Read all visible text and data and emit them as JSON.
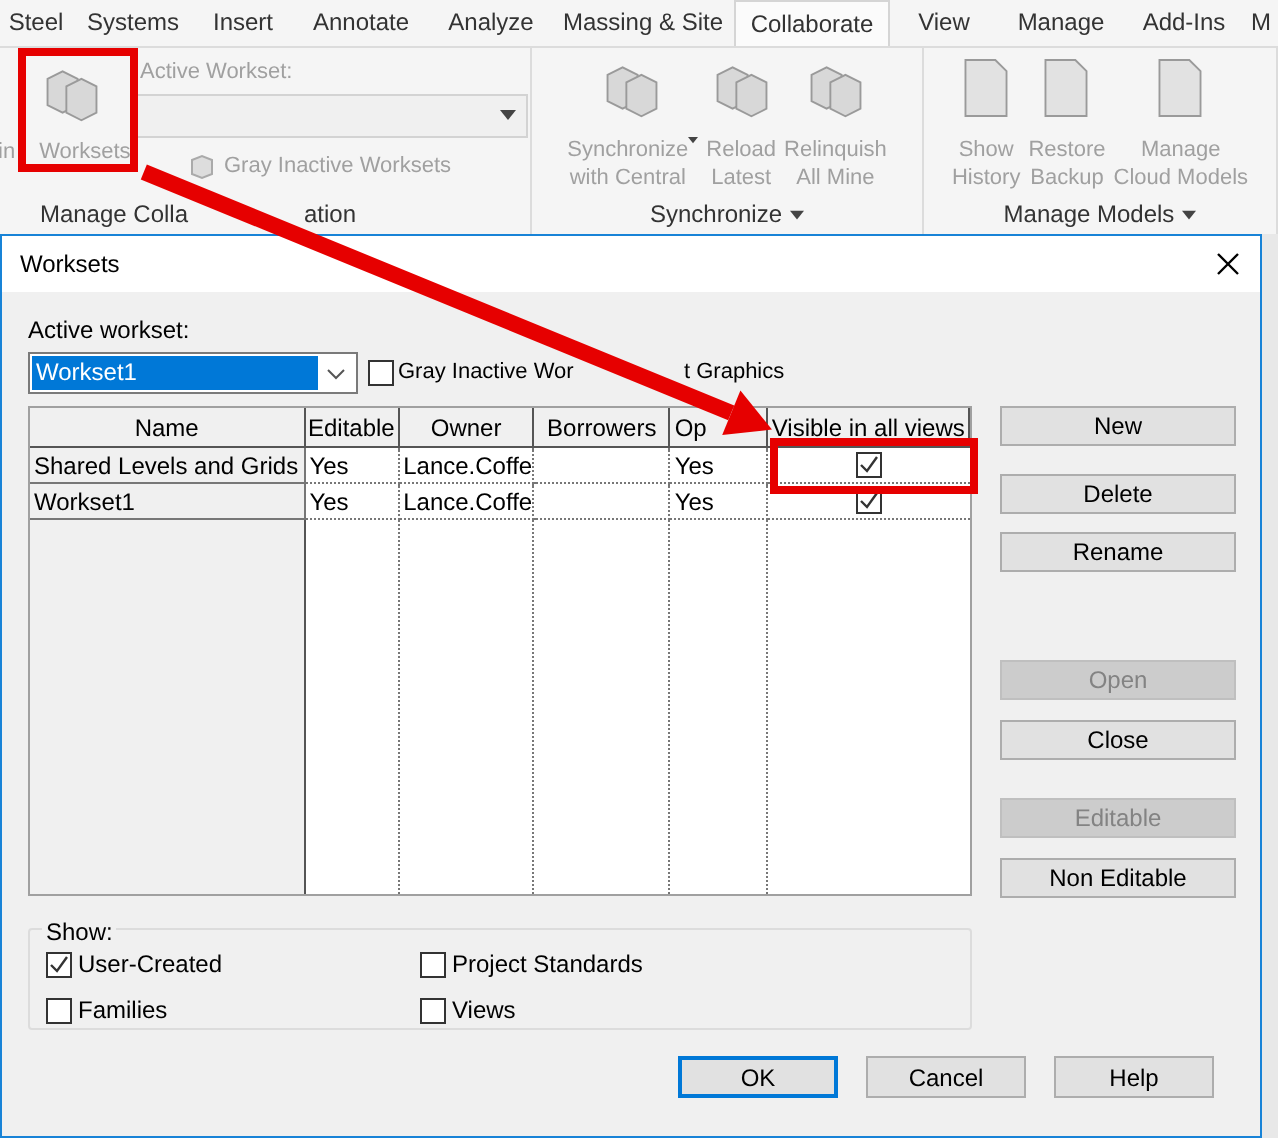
{
  "ribbon": {
    "tabs": [
      {
        "label": "Steel",
        "selected": false
      },
      {
        "label": "Systems",
        "selected": false
      },
      {
        "label": "Insert",
        "selected": false
      },
      {
        "label": "Annotate",
        "selected": false
      },
      {
        "label": "Analyze",
        "selected": false
      },
      {
        "label": "Massing & Site",
        "selected": false
      },
      {
        "label": "Collaborate",
        "selected": true
      },
      {
        "label": "View",
        "selected": false
      },
      {
        "label": "Manage",
        "selected": false
      },
      {
        "label": "Add-Ins",
        "selected": false
      },
      {
        "label": "M",
        "selected": false
      }
    ],
    "manage_collaboration": {
      "worksets_button": "in Worksets",
      "active_workset_label": "Active Workset:",
      "gray_inactive_button": "Gray Inactive Worksets",
      "label_parts": [
        "Manage Colla",
        "ation"
      ],
      "disabled": true
    },
    "synchronize": {
      "buttons": [
        {
          "label": "Synchronize\nwith Central",
          "kind": "split"
        },
        {
          "label": "Reload\nLatest",
          "kind": "plain"
        },
        {
          "label": "Relinquish\nAll Mine",
          "kind": "plain"
        }
      ],
      "label": "Synchronize",
      "disabled": true
    },
    "manage_models": {
      "buttons": [
        {
          "label": "Show\nHistory"
        },
        {
          "label": "Restore\nBackup"
        },
        {
          "label": "Manage\nCloud Models"
        }
      ],
      "label": "Manage Models",
      "disabled": true
    }
  },
  "dialog": {
    "title": "Worksets",
    "active_label": "Active workset:",
    "active_value": "Workset1",
    "gray_inactive": {
      "label_parts": [
        "Gray Inactive Wor",
        "t Graphics"
      ],
      "checked": false
    },
    "table": {
      "columns": [
        "Name",
        "Editable",
        "Owner",
        "Borrowers",
        "Op",
        "Visible in all views"
      ],
      "rows": [
        {
          "name": "Shared Levels and Grids",
          "editable": "Yes",
          "owner": "Lance.Coffe",
          "opened": "Yes",
          "visible": true
        },
        {
          "name": "Workset1",
          "editable": "Yes",
          "owner": "Lance.Coffe",
          "opened": "Yes",
          "visible": true
        }
      ]
    },
    "side_buttons": [
      {
        "label": "New",
        "disabled": false
      },
      {
        "label": "Delete",
        "disabled": false
      },
      {
        "label": "Rename",
        "disabled": false
      },
      {
        "label": "Open",
        "disabled": true
      },
      {
        "label": "Close",
        "disabled": false
      },
      {
        "label": "Editable",
        "disabled": true
      },
      {
        "label": "Non Editable",
        "disabled": false
      }
    ],
    "show": {
      "label": "Show:",
      "options": [
        {
          "label": "User-Created",
          "checked": true
        },
        {
          "label": "Project Standards",
          "checked": false
        },
        {
          "label": "Families",
          "checked": false
        },
        {
          "label": "Views",
          "checked": false
        }
      ]
    },
    "footer_buttons": [
      {
        "label": "OK",
        "selected": true
      },
      {
        "label": "Cancel",
        "selected": false
      },
      {
        "label": "Help",
        "selected": false
      }
    ]
  }
}
